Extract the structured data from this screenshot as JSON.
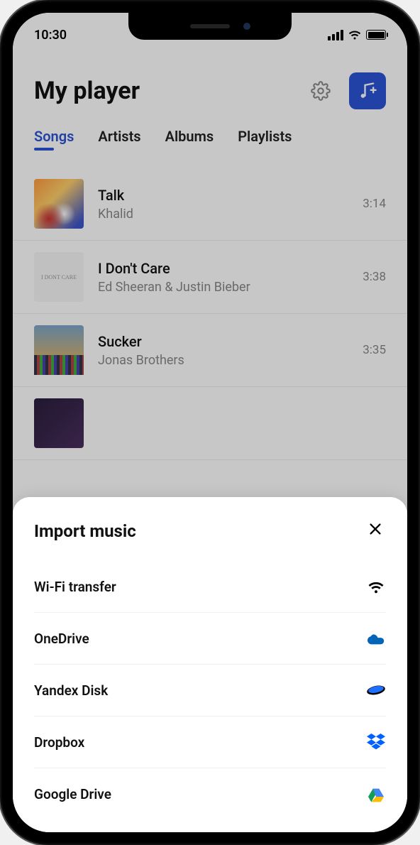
{
  "status": {
    "time": "10:30"
  },
  "header": {
    "title": "My player"
  },
  "tabs": [
    {
      "label": "Songs",
      "active": true
    },
    {
      "label": "Artists",
      "active": false
    },
    {
      "label": "Albums",
      "active": false
    },
    {
      "label": "Playlists",
      "active": false
    }
  ],
  "songs": [
    {
      "title": "Talk",
      "artist": "Khalid",
      "duration": "3:14",
      "art": "art-1"
    },
    {
      "title": "I Don't Care",
      "artist": "Ed Sheeran & Justin Bieber",
      "duration": "3:38",
      "art": "art-2"
    },
    {
      "title": "Sucker",
      "artist": "Jonas Brothers",
      "duration": "3:35",
      "art": "art-3"
    },
    {
      "title": "",
      "artist": "",
      "duration": "",
      "art": "art-4"
    }
  ],
  "sheet": {
    "title": "Import music",
    "items": [
      {
        "label": "Wi-Fi transfer",
        "icon": "wifi-icon"
      },
      {
        "label": "OneDrive",
        "icon": "onedrive-icon"
      },
      {
        "label": "Yandex Disk",
        "icon": "yandexdisk-icon"
      },
      {
        "label": "Dropbox",
        "icon": "dropbox-icon"
      },
      {
        "label": "Google Drive",
        "icon": "googledrive-icon"
      }
    ]
  }
}
